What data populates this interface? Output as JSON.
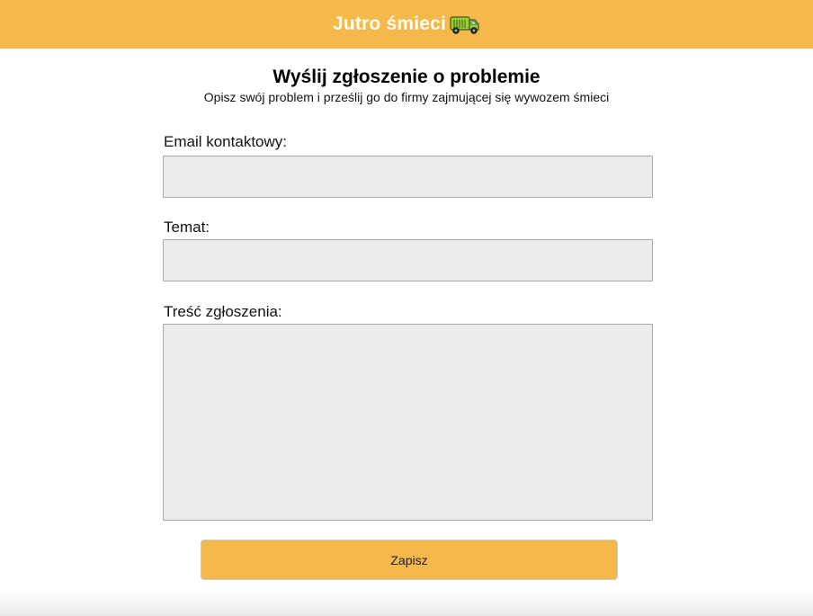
{
  "header": {
    "title": "Jutro śmieci"
  },
  "form": {
    "title": "Wyślij zgłoszenie o problemie",
    "subtitle": "Opisz swój problem i prześlij go do firmy zajmującej się wywozem śmieci",
    "email_label": "Email kontaktowy:",
    "email_value": "",
    "subject_label": "Temat:",
    "subject_value": "",
    "body_label": "Treść zgłoszenia:",
    "body_value": "",
    "submit_label": "Zapisz"
  },
  "icons": {
    "header_icon": "garbage-truck-icon"
  },
  "colors": {
    "accent": "#f4b94a",
    "input_background": "#ebebeb"
  }
}
